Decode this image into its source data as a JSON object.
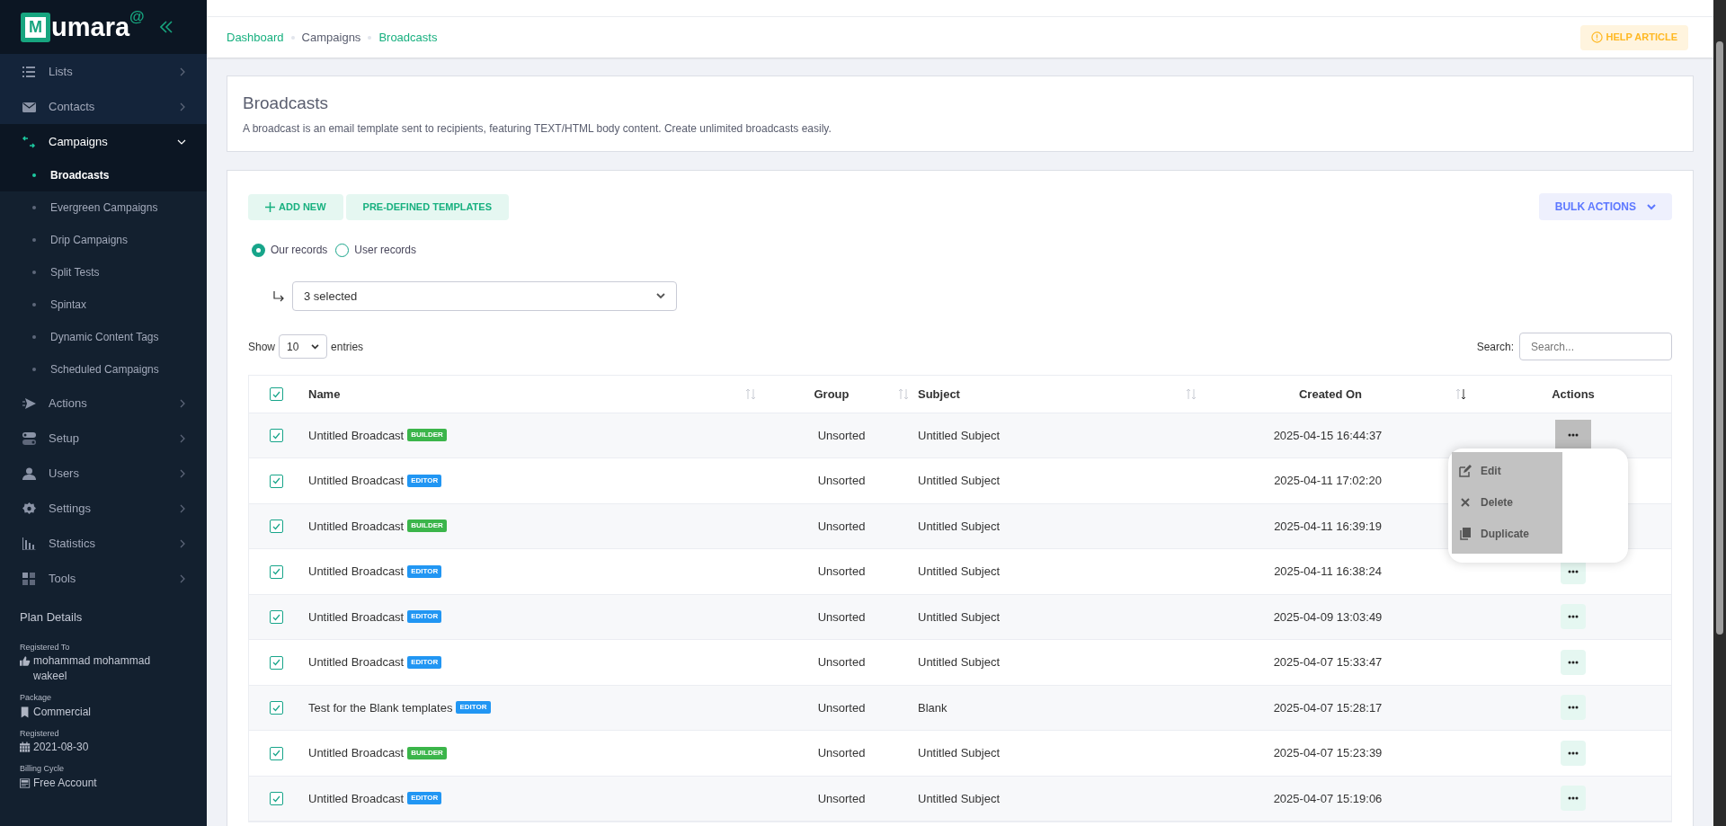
{
  "logo": {
    "letter": "M",
    "text": "umara",
    "superscript": "@"
  },
  "sidebar": {
    "items": [
      {
        "label": "Lists",
        "kind": "list",
        "expanded": false
      },
      {
        "label": "Contacts",
        "kind": "mail",
        "expanded": false
      },
      {
        "label": "Campaigns",
        "kind": "swap",
        "expanded": true,
        "children": [
          {
            "label": "Broadcasts",
            "selected": true
          },
          {
            "label": "Evergreen Campaigns",
            "selected": false
          },
          {
            "label": "Drip Campaigns",
            "selected": false
          },
          {
            "label": "Split Tests",
            "selected": false
          },
          {
            "label": "Spintax",
            "selected": false
          },
          {
            "label": "Dynamic Content Tags",
            "selected": false
          },
          {
            "label": "Scheduled Campaigns",
            "selected": false
          }
        ]
      },
      {
        "label": "Actions",
        "kind": "send",
        "expanded": false
      },
      {
        "label": "Setup",
        "kind": "toggle",
        "expanded": false
      },
      {
        "label": "Users",
        "kind": "user",
        "expanded": false
      },
      {
        "label": "Settings",
        "kind": "gear",
        "expanded": false
      },
      {
        "label": "Statistics",
        "kind": "chart",
        "expanded": false
      },
      {
        "label": "Tools",
        "kind": "grid",
        "expanded": false
      }
    ],
    "plan": {
      "title": "Plan Details",
      "fields": [
        {
          "label": "Registered To",
          "value": "mohammad mohammad wakeel",
          "kind": "thumb"
        },
        {
          "label": "Package",
          "value": "Commercial",
          "kind": "bookmark"
        },
        {
          "label": "Registered",
          "value": "2021-08-30",
          "kind": "calendar"
        },
        {
          "label": "Billing Cycle",
          "value": "Free Account",
          "kind": "card"
        }
      ]
    }
  },
  "breadcrumb": [
    {
      "label": "Dashboard",
      "link": true
    },
    {
      "label": "Campaigns",
      "link": false
    },
    {
      "label": "Broadcasts",
      "link": true
    }
  ],
  "help_button": "HELP ARTICLE",
  "page_header": {
    "title": "Broadcasts",
    "description": "A broadcast is an email template sent to recipients, featuring TEXT/HTML body content. Create unlimited broadcasts easily."
  },
  "toolbar": {
    "buttons": [
      {
        "label": "ADD NEW",
        "kind": "add"
      },
      {
        "label": "PRE-DEFINED TEMPLATES",
        "kind": "plain"
      }
    ],
    "bulk_actions": "BULK ACTIONS"
  },
  "record_filter": {
    "options": [
      {
        "label": "Our records",
        "selected": true
      },
      {
        "label": "User records",
        "selected": false
      }
    ],
    "select_value": "3 selected"
  },
  "length": {
    "before": "Show",
    "value": "10",
    "after": "entries"
  },
  "search": {
    "label": "Search:",
    "placeholder": "Search..."
  },
  "table": {
    "all_checked": true,
    "columns": [
      {
        "label": "Name",
        "sorted_desc": false
      },
      {
        "label": "Group",
        "sorted_desc": false
      },
      {
        "label": "Subject",
        "sorted_desc": false
      },
      {
        "label": "Created On",
        "sorted_desc": true
      },
      {
        "label": "Actions"
      }
    ],
    "rows": [
      {
        "checked": true,
        "name": "Untitled Broadcast",
        "badge": "BUILDER",
        "color": "#3bb54a",
        "group": "Unsorted",
        "subject": "Untitled Subject",
        "created_on": "2025-04-15 16:44:37",
        "menu_open": true
      },
      {
        "checked": true,
        "name": "Untitled Broadcast",
        "badge": "EDITOR",
        "color": "#2196f3",
        "group": "Unsorted",
        "subject": "Untitled Subject",
        "created_on": "2025-04-11 17:02:20",
        "menu_open": false
      },
      {
        "checked": true,
        "name": "Untitled Broadcast",
        "badge": "BUILDER",
        "color": "#3bb54a",
        "group": "Unsorted",
        "subject": "Untitled Subject",
        "created_on": "2025-04-11 16:39:19",
        "menu_open": false
      },
      {
        "checked": true,
        "name": "Untitled Broadcast",
        "badge": "EDITOR",
        "color": "#2196f3",
        "group": "Unsorted",
        "subject": "Untitled Subject",
        "created_on": "2025-04-11 16:38:24",
        "menu_open": false
      },
      {
        "checked": true,
        "name": "Untitled Broadcast",
        "badge": "EDITOR",
        "color": "#2196f3",
        "group": "Unsorted",
        "subject": "Untitled Subject",
        "created_on": "2025-04-09 13:03:49",
        "menu_open": false
      },
      {
        "checked": true,
        "name": "Untitled Broadcast",
        "badge": "EDITOR",
        "color": "#2196f3",
        "group": "Unsorted",
        "subject": "Untitled Subject",
        "created_on": "2025-04-07 15:33:47",
        "menu_open": false
      },
      {
        "checked": true,
        "name": "Test for the Blank templates",
        "badge": "EDITOR",
        "color": "#2196f3",
        "group": "Unsorted",
        "subject": "Blank",
        "created_on": "2025-04-07 15:28:17",
        "menu_open": false
      },
      {
        "checked": true,
        "name": "Untitled Broadcast",
        "badge": "BUILDER",
        "color": "#3bb54a",
        "group": "Unsorted",
        "subject": "Untitled Subject",
        "created_on": "2025-04-07 15:23:39",
        "menu_open": false
      },
      {
        "checked": true,
        "name": "Untitled Broadcast",
        "badge": "EDITOR",
        "color": "#2196f3",
        "group": "Unsorted",
        "subject": "Untitled Subject",
        "created_on": "2025-04-07 15:19:06",
        "menu_open": false
      }
    ],
    "row_menu": [
      {
        "label": "Edit",
        "kind": "edit"
      },
      {
        "label": "Delete",
        "kind": "delete"
      },
      {
        "label": "Duplicate",
        "kind": "copy"
      }
    ]
  }
}
